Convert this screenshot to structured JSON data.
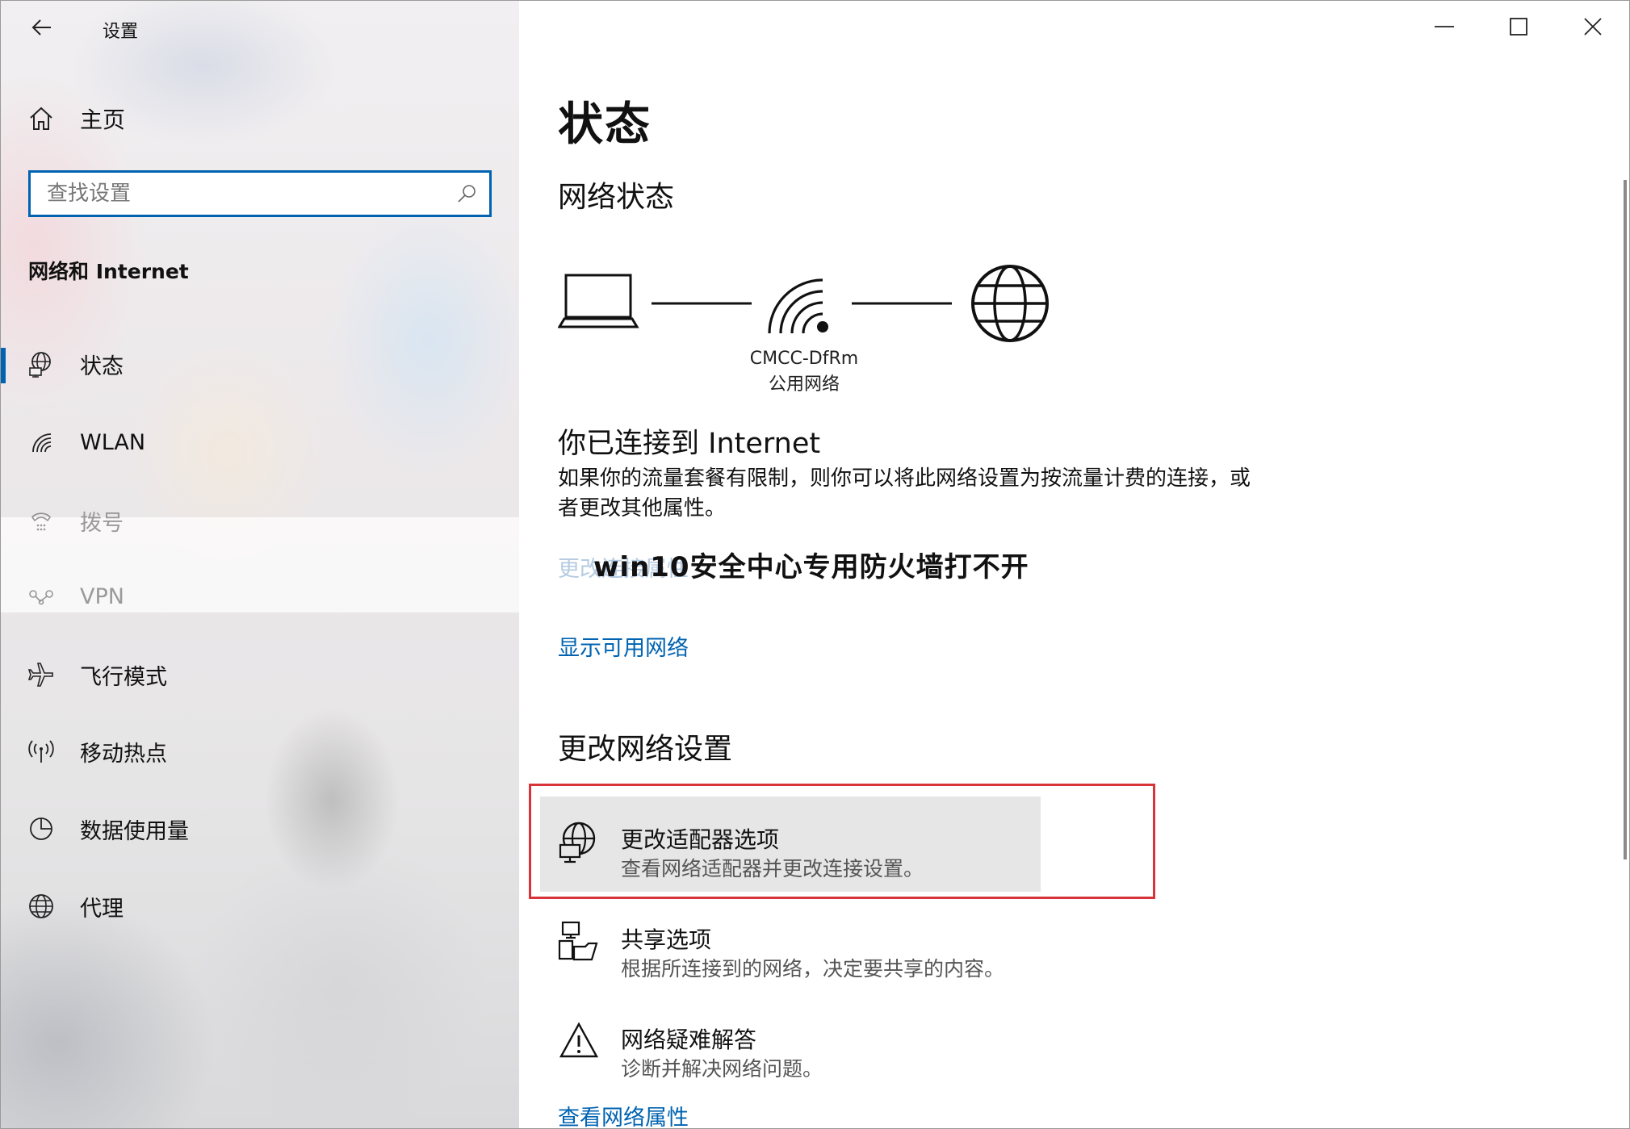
{
  "window": {
    "app_title": "设置",
    "controls": {
      "minimize": "minimize",
      "maximize": "maximize",
      "close": "close"
    }
  },
  "sidebar": {
    "home_label": "主页",
    "search": {
      "placeholder": "查找设置",
      "value": ""
    },
    "section_title": "网络和 Internet",
    "items": [
      {
        "label": "状态",
        "icon": "status-globe-icon",
        "active": true
      },
      {
        "label": "WLAN",
        "icon": "wifi-icon"
      },
      {
        "label": "拨号",
        "icon": "dialup-icon"
      },
      {
        "label": "VPN",
        "icon": "vpn-icon"
      },
      {
        "label": "飞行模式",
        "icon": "airplane-icon"
      },
      {
        "label": "移动热点",
        "icon": "hotspot-icon"
      },
      {
        "label": "数据使用量",
        "icon": "data-usage-icon"
      },
      {
        "label": "代理",
        "icon": "globe-icon"
      }
    ]
  },
  "main": {
    "page_title": "状态",
    "network_status_heading": "网络状态",
    "network": {
      "name": "CMCC-DfRm",
      "type": "公用网络"
    },
    "connected_heading": "你已连接到 Internet",
    "connected_desc": "如果你的流量套餐有限制，则你可以将此网络设置为按流量计费的连接，或者更改其他属性。",
    "change_props_link": "更改连接属性",
    "overlay_caption": "win10安全中心专用防火墙打不开",
    "show_networks_link": "显示可用网络",
    "change_settings_heading": "更改网络设置",
    "options": [
      {
        "title": "更改适配器选项",
        "subtitle": "查看网络适配器并更改连接设置。",
        "icon": "adapter-globe-icon",
        "highlighted": true
      },
      {
        "title": "共享选项",
        "subtitle": "根据所连接到的网络，决定要共享的内容。",
        "icon": "sharing-icon"
      },
      {
        "title": "网络疑难解答",
        "subtitle": "诊断并解决网络问题。",
        "icon": "warning-icon"
      }
    ],
    "view_props_link": "查看网络属性"
  }
}
